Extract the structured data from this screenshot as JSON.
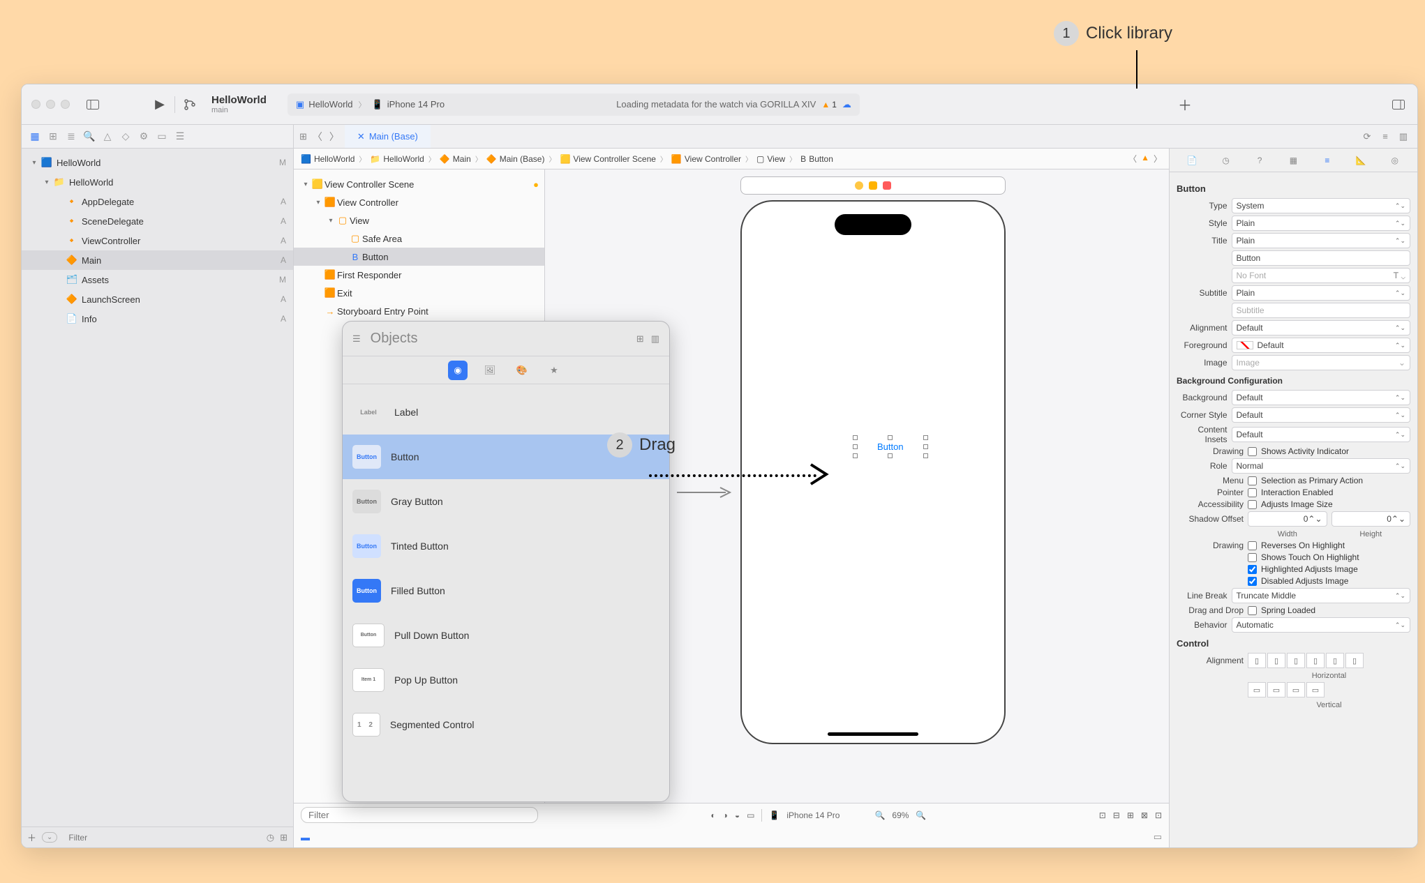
{
  "annotations": {
    "step1": {
      "num": "1",
      "text": "Click library"
    },
    "step2": {
      "num": "2",
      "text": "Drag"
    }
  },
  "titlebar": {
    "project": "HelloWorld",
    "branch": "main",
    "scheme_app": "HelloWorld",
    "scheme_device": "iPhone 14 Pro",
    "status": "Loading metadata for the watch via GORILLA XIV",
    "warning_count": "1"
  },
  "tabbar": {
    "main_tab": "Main (Base)"
  },
  "navigator": {
    "items": [
      {
        "indent": 0,
        "chev": "▾",
        "icon": "🟦",
        "label": "HelloWorld",
        "stat": "M",
        "sel": false,
        "color": "#3478f6"
      },
      {
        "indent": 1,
        "chev": "▾",
        "icon": "📁",
        "label": "HelloWorld",
        "stat": "",
        "sel": false
      },
      {
        "indent": 2,
        "chev": "",
        "icon": "🔸",
        "label": "AppDelegate",
        "stat": "A",
        "sel": false,
        "iconcolor": "#ff9500"
      },
      {
        "indent": 2,
        "chev": "",
        "icon": "🔸",
        "label": "SceneDelegate",
        "stat": "A",
        "sel": false,
        "iconcolor": "#ff9500"
      },
      {
        "indent": 2,
        "chev": "",
        "icon": "🔸",
        "label": "ViewController",
        "stat": "A",
        "sel": false,
        "iconcolor": "#ff9500"
      },
      {
        "indent": 2,
        "chev": "",
        "icon": "🔶",
        "label": "Main",
        "stat": "A",
        "sel": true,
        "iconcolor": "#ff9500"
      },
      {
        "indent": 2,
        "chev": "",
        "icon": "🗂",
        "label": "Assets",
        "stat": "M",
        "sel": false,
        "iconcolor": "#44aadd"
      },
      {
        "indent": 2,
        "chev": "",
        "icon": "🔶",
        "label": "LaunchScreen",
        "stat": "A",
        "sel": false,
        "iconcolor": "#ff9500"
      },
      {
        "indent": 2,
        "chev": "",
        "icon": "📄",
        "label": "Info",
        "stat": "A",
        "sel": false
      }
    ],
    "filter_ph": "Filter"
  },
  "breadcrumbs": [
    {
      "icon": "🟦",
      "label": "HelloWorld"
    },
    {
      "icon": "📁",
      "label": "HelloWorld"
    },
    {
      "icon": "🔶",
      "label": "Main"
    },
    {
      "icon": "🔶",
      "label": "Main (Base)"
    },
    {
      "icon": "🟨",
      "label": "View Controller Scene"
    },
    {
      "icon": "🟧",
      "label": "View Controller"
    },
    {
      "icon": "▢",
      "label": "View"
    },
    {
      "icon": "B",
      "label": "Button"
    }
  ],
  "outline": [
    {
      "indent": 0,
      "chev": "▾",
      "icon": "🟨",
      "label": "View Controller Scene",
      "sel": false,
      "right": "●"
    },
    {
      "indent": 1,
      "chev": "▾",
      "icon": "🟧",
      "label": "View Controller",
      "sel": false
    },
    {
      "indent": 2,
      "chev": "▾",
      "icon": "▢",
      "label": "View",
      "sel": false
    },
    {
      "indent": 3,
      "chev": "",
      "icon": "▢",
      "label": "Safe Area",
      "sel": false
    },
    {
      "indent": 3,
      "chev": "",
      "icon": "B",
      "label": "Button",
      "sel": true,
      "iconcolor": "#3478f6"
    },
    {
      "indent": 1,
      "chev": "",
      "icon": "🟧",
      "label": "First Responder",
      "sel": false
    },
    {
      "indent": 1,
      "chev": "",
      "icon": "🟧",
      "label": "Exit",
      "sel": false
    },
    {
      "indent": 1,
      "chev": "",
      "icon": "→",
      "label": "Storyboard Entry Point",
      "sel": false
    }
  ],
  "outline_filter_ph": "Filter",
  "canvas": {
    "button_label": "Button",
    "device_name": "iPhone 14 Pro",
    "zoom": "69%"
  },
  "library": {
    "title": "Objects",
    "items": [
      {
        "thumb": "Label",
        "thumb_class": "label",
        "label": "Label"
      },
      {
        "thumb": "Button",
        "thumb_class": "btn-plain",
        "label": "Button",
        "sel": true
      },
      {
        "thumb": "Button",
        "thumb_class": "btn-gray",
        "label": "Gray Button"
      },
      {
        "thumb": "Button",
        "thumb_class": "btn-tint",
        "label": "Tinted Button"
      },
      {
        "thumb": "Button",
        "thumb_class": "btn-blue",
        "label": "Filled Button"
      },
      {
        "thumb": "Button",
        "thumb_class": "pulldown",
        "label": "Pull Down Button"
      },
      {
        "thumb": "Item 1",
        "thumb_class": "popup",
        "label": "Pop Up Button"
      },
      {
        "thumb": "1  2",
        "thumb_class": "seg",
        "label": "Segmented Control"
      }
    ]
  },
  "inspector": {
    "header": "Button",
    "rows": {
      "type": "System",
      "style": "Plain",
      "title_mode": "Plain",
      "title_text": "Button",
      "font": "No Font",
      "subtitle_mode": "Plain",
      "subtitle_ph": "Subtitle",
      "alignment": "Default",
      "foreground": "Default",
      "image_ph": "Image",
      "bg_header": "Background Configuration",
      "background": "Default",
      "corner_style": "Default",
      "content_insets": "Default",
      "drawing_act": "Shows Activity Indicator",
      "role": "Normal",
      "menu": "Selection as Primary Action",
      "pointer": "Interaction Enabled",
      "accessibility": "Adjusts Image Size",
      "shadow_w": "0",
      "shadow_h": "0",
      "shadow_w_lab": "Width",
      "shadow_h_lab": "Height",
      "rev": "Reverses On Highlight",
      "touch": "Shows Touch On Highlight",
      "hl_adj": "Highlighted Adjusts Image",
      "dis_adj": "Disabled Adjusts Image",
      "line_break": "Truncate Middle",
      "dragdrop": "Spring Loaded",
      "behavior": "Automatic",
      "control_hdr": "Control",
      "ctl_align": "Alignment",
      "horiz": "Horizontal",
      "vert": "Vertical"
    },
    "labels": {
      "type": "Type",
      "style": "Style",
      "title": "Title",
      "subtitle": "Subtitle",
      "alignment": "Alignment",
      "foreground": "Foreground",
      "image": "Image",
      "background": "Background",
      "corner": "Corner Style",
      "insets": "Content Insets",
      "drawing": "Drawing",
      "role": "Role",
      "menu": "Menu",
      "pointer": "Pointer",
      "accessibility": "Accessibility",
      "shadow": "Shadow Offset",
      "linebreak": "Line Break",
      "dragdrop": "Drag and Drop",
      "behavior": "Behavior"
    }
  }
}
